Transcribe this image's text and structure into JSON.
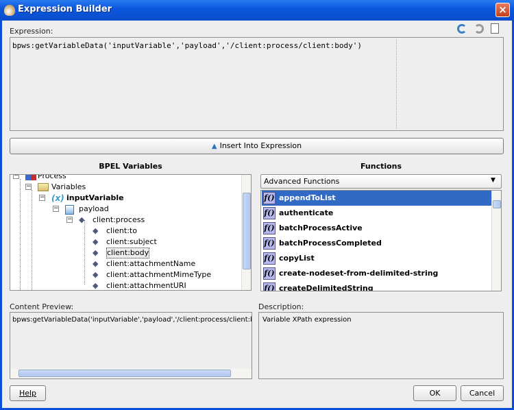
{
  "window": {
    "title": "Expression Builder",
    "close": "×"
  },
  "expression": {
    "label": "Expression:",
    "value": "bpws:getVariableData('inputVariable','payload','/client:process/client:body')",
    "icons": [
      "undo-icon",
      "redo-icon",
      "clear-document-icon"
    ]
  },
  "insert_button": {
    "label": "Insert Into Expression",
    "icon": "chevron-up-icon"
  },
  "variables": {
    "heading": "BPEL Variables",
    "tree": [
      {
        "label": "Process",
        "level": 0,
        "icon": "process-icon"
      },
      {
        "label": "Variables",
        "level": 1,
        "icon": "folder-icon"
      },
      {
        "label": "inputVariable",
        "level": 2,
        "icon": "variable-icon",
        "bold": true
      },
      {
        "label": "payload",
        "level": 3,
        "icon": "message-part-icon"
      },
      {
        "label": "client:process",
        "level": 4,
        "icon": "element-icon"
      },
      {
        "label": "client:to",
        "level": 5,
        "icon": "element-icon"
      },
      {
        "label": "client:subject",
        "level": 5,
        "icon": "element-icon"
      },
      {
        "label": "client:body",
        "level": 5,
        "icon": "element-icon",
        "selected": true
      },
      {
        "label": "client:attachmentName",
        "level": 5,
        "icon": "element-icon"
      },
      {
        "label": "client:attachmentMimeType",
        "level": 5,
        "icon": "element-icon"
      },
      {
        "label": "client:attachmentURI",
        "level": 5,
        "icon": "element-icon"
      }
    ]
  },
  "functions": {
    "heading": "Functions",
    "category": "Advanced Functions",
    "icon_text": "f()",
    "items": [
      "appendToList",
      "authenticate",
      "batchProcessActive",
      "batchProcessCompleted",
      "copyList",
      "create-nodeset-from-delimited-string",
      "createDelimitedString"
    ],
    "selected": "appendToList"
  },
  "content_preview": {
    "label": "Content Preview:",
    "value": "bpws:getVariableData('inputVariable','payload','/client:process/client:body')"
  },
  "description": {
    "label": "Description:",
    "value": "Variable XPath expression"
  },
  "buttons": {
    "help": "Help",
    "ok": "OK",
    "cancel": "Cancel"
  },
  "colors": {
    "selection": "#316ac5",
    "titlebar": "#0b58dc"
  }
}
